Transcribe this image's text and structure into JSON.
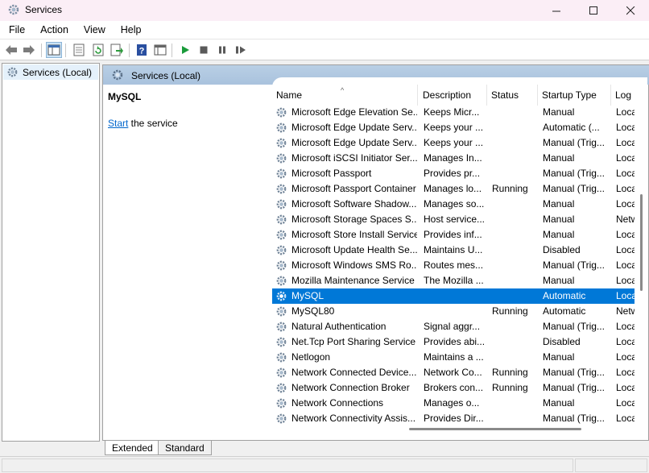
{
  "window": {
    "title": "Services"
  },
  "menu": [
    "File",
    "Action",
    "View",
    "Help"
  ],
  "tree": {
    "root": "Services (Local)"
  },
  "header": {
    "title": "Services (Local)"
  },
  "details": {
    "service_name": "MySQL",
    "start_link": "Start",
    "start_suffix": " the service"
  },
  "columns": {
    "name": "Name",
    "description": "Description",
    "status": "Status",
    "startup_type": "Startup Type",
    "log_on_as": "Log"
  },
  "services": [
    {
      "name": "Microsoft Edge Elevation Se...",
      "description": "Keeps Micr...",
      "status": "",
      "startup": "Manual",
      "logon": "Loca"
    },
    {
      "name": "Microsoft Edge Update Serv...",
      "description": "Keeps your ...",
      "status": "",
      "startup": "Automatic (...",
      "logon": "Loca"
    },
    {
      "name": "Microsoft Edge Update Serv...",
      "description": "Keeps your ...",
      "status": "",
      "startup": "Manual (Trig...",
      "logon": "Loca"
    },
    {
      "name": "Microsoft iSCSI Initiator Ser...",
      "description": "Manages In...",
      "status": "",
      "startup": "Manual",
      "logon": "Loca"
    },
    {
      "name": "Microsoft Passport",
      "description": "Provides pr...",
      "status": "",
      "startup": "Manual (Trig...",
      "logon": "Loca"
    },
    {
      "name": "Microsoft Passport Container",
      "description": "Manages lo...",
      "status": "Running",
      "startup": "Manual (Trig...",
      "logon": "Loca"
    },
    {
      "name": "Microsoft Software Shadow...",
      "description": "Manages so...",
      "status": "",
      "startup": "Manual",
      "logon": "Loca"
    },
    {
      "name": "Microsoft Storage Spaces S...",
      "description": "Host service...",
      "status": "",
      "startup": "Manual",
      "logon": "Netw"
    },
    {
      "name": "Microsoft Store Install Service",
      "description": "Provides inf...",
      "status": "",
      "startup": "Manual",
      "logon": "Loca"
    },
    {
      "name": "Microsoft Update Health Se...",
      "description": "Maintains U...",
      "status": "",
      "startup": "Disabled",
      "logon": "Loca"
    },
    {
      "name": "Microsoft Windows SMS Ro...",
      "description": "Routes mes...",
      "status": "",
      "startup": "Manual (Trig...",
      "logon": "Loca"
    },
    {
      "name": "Mozilla Maintenance Service",
      "description": "The Mozilla ...",
      "status": "",
      "startup": "Manual",
      "logon": "Loca"
    },
    {
      "name": "MySQL",
      "description": "",
      "status": "",
      "startup": "Automatic",
      "logon": "Loca",
      "selected": true
    },
    {
      "name": "MySQL80",
      "description": "",
      "status": "Running",
      "startup": "Automatic",
      "logon": "Netw"
    },
    {
      "name": "Natural Authentication",
      "description": "Signal aggr...",
      "status": "",
      "startup": "Manual (Trig...",
      "logon": "Loca"
    },
    {
      "name": "Net.Tcp Port Sharing Service",
      "description": "Provides abi...",
      "status": "",
      "startup": "Disabled",
      "logon": "Loca"
    },
    {
      "name": "Netlogon",
      "description": "Maintains a ...",
      "status": "",
      "startup": "Manual",
      "logon": "Loca"
    },
    {
      "name": "Network Connected Device...",
      "description": "Network Co...",
      "status": "Running",
      "startup": "Manual (Trig...",
      "logon": "Loca"
    },
    {
      "name": "Network Connection Broker",
      "description": "Brokers con...",
      "status": "Running",
      "startup": "Manual (Trig...",
      "logon": "Loca"
    },
    {
      "name": "Network Connections",
      "description": "Manages o...",
      "status": "",
      "startup": "Manual",
      "logon": "Loca"
    },
    {
      "name": "Network Connectivity Assis...",
      "description": "Provides Dir...",
      "status": "",
      "startup": "Manual (Trig...",
      "logon": "Loca"
    }
  ],
  "tabs": [
    "Extended",
    "Standard"
  ],
  "colors": {
    "selection": "#0078d7",
    "header_band": "#b9cfe5",
    "link": "#0066cc",
    "play": "#1a9b3a"
  },
  "icons": [
    "services-app-icon",
    "back-arrow-icon",
    "forward-arrow-icon",
    "show-hide-tree-icon",
    "properties-icon",
    "refresh-icon",
    "export-list-icon",
    "help-icon",
    "console-view-icon",
    "play-icon",
    "stop-icon",
    "pause-icon",
    "resume-icon",
    "gear-icon"
  ]
}
